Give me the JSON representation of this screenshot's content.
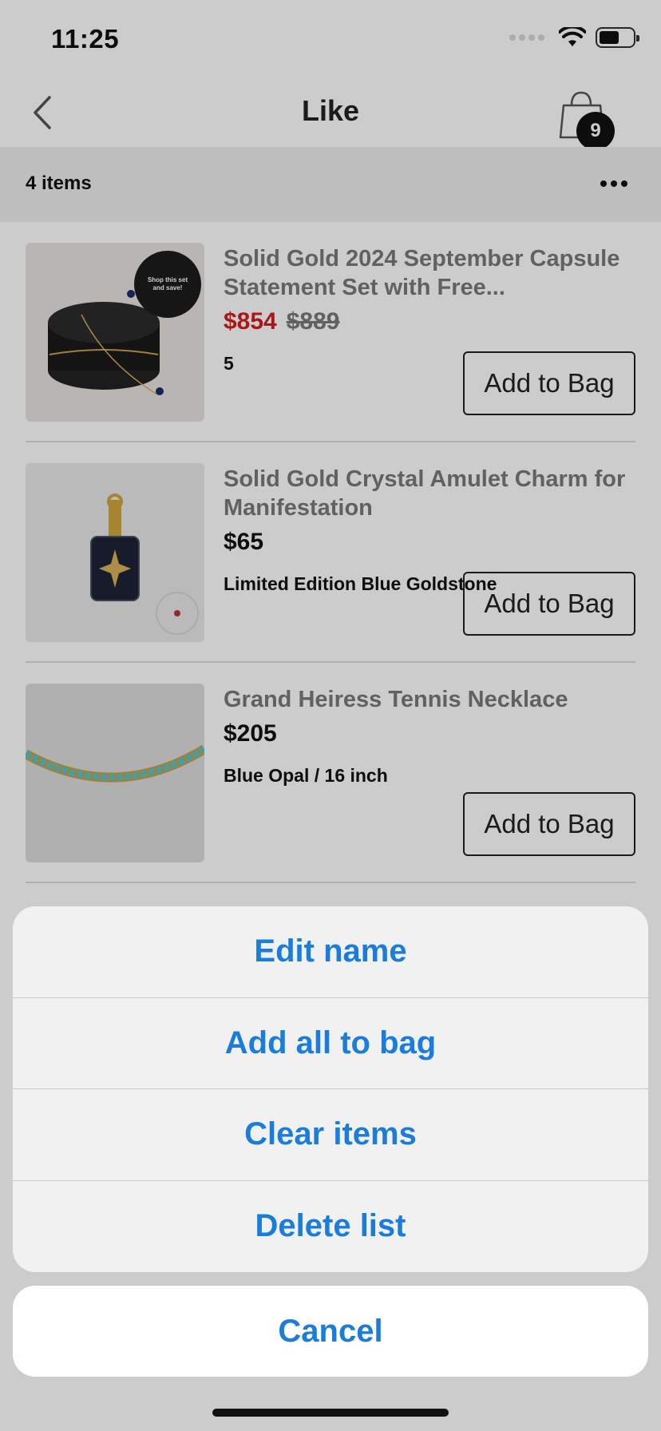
{
  "status_bar": {
    "time": "11:25"
  },
  "nav": {
    "title": "Like",
    "bag_count": "9"
  },
  "subheader": {
    "items_count": "4 items"
  },
  "products": [
    {
      "name": "Solid Gold 2024 September Capsule Statement Set with Free...",
      "sale_price": "$854",
      "original_price": "$889",
      "variant": "5",
      "add_label": "Add to Bag",
      "image_badge": "Shop this set and save!"
    },
    {
      "name": "Solid Gold Crystal Amulet Charm for Manifestation",
      "price": "$65",
      "variant": "Limited Edition Blue Goldstone",
      "add_label": "Add to Bag"
    },
    {
      "name": "Grand Heiress Tennis Necklace",
      "price": "$205",
      "variant": "Blue Opal / 16 inch",
      "add_label": "Add to Bag"
    }
  ],
  "action_sheet": {
    "actions": [
      "Edit name",
      "Add all to bag",
      "Clear items",
      "Delete list"
    ],
    "cancel": "Cancel"
  },
  "colors": {
    "accent": "#1a7cdb",
    "sale": "#d21f1f"
  }
}
